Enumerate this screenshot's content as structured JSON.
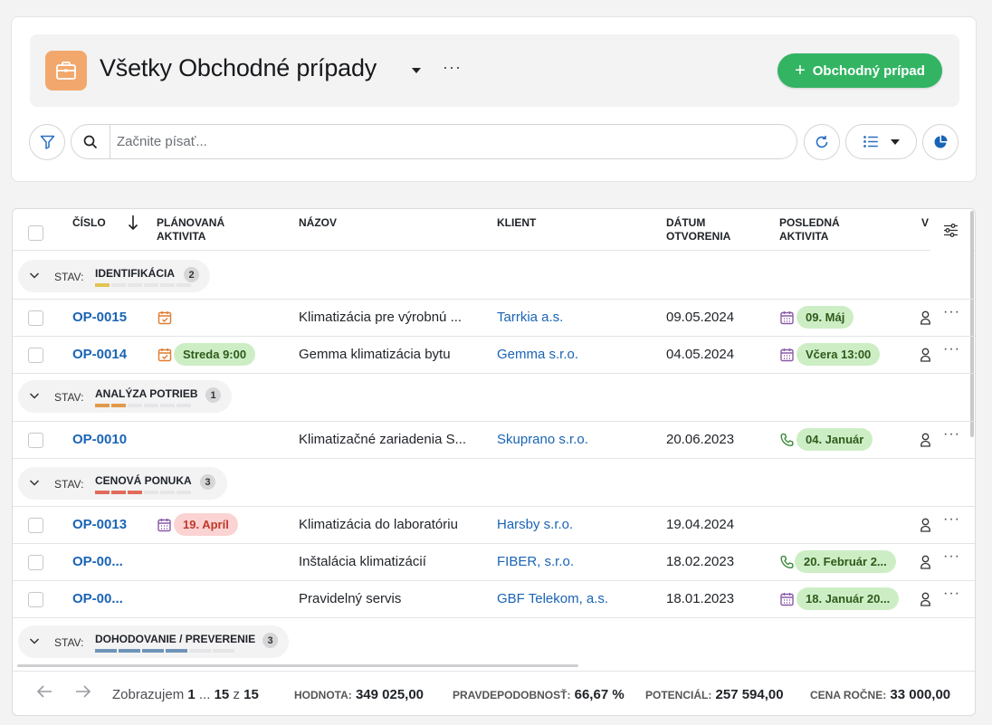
{
  "header": {
    "title": "Všetky Obchodné prípady",
    "more": "···",
    "add_button": "Obchodný prípad"
  },
  "search": {
    "placeholder": "Začnite písať..."
  },
  "table": {
    "columns": {
      "cislo": "Číslo",
      "planovana_1": "Plánovaná",
      "planovana_2": "aktivita",
      "nazov": "Názov",
      "klient": "Klient",
      "datum_1": "Dátum",
      "datum_2": "otvorenia",
      "posledna_1": "Posledná",
      "posledna_2": "aktivita",
      "cut": "V"
    },
    "groups": [
      {
        "stav": "STAV:",
        "name": "IDENTIFIKÁCIA",
        "count": "2"
      },
      {
        "stav": "STAV:",
        "name": "ANALÝZA POTRIEB",
        "count": "1"
      },
      {
        "stav": "STAV:",
        "name": "CENOVÁ PONUKA",
        "count": "3"
      },
      {
        "stav": "STAV:",
        "name": "DOHODOVANIE / PREVERENIE",
        "count": "3"
      }
    ],
    "rows": [
      {
        "number": "OP-0015",
        "name": "Klimatizácia pre výrobnú ...",
        "client": "Tarrkia a.s.",
        "date": "09.05.2024",
        "planned": "",
        "last": "09. Máj",
        "more": "···"
      },
      {
        "number": "OP-0014",
        "name": "Gemma klimatizácia bytu",
        "client": "Gemma s.r.o.",
        "date": "04.05.2024",
        "planned": "Streda 9:00",
        "last": "Včera 13:00",
        "more": "···"
      },
      {
        "number": "OP-0010",
        "name": "Klimatizačné zariadenia S...",
        "client": "Skuprano s.r.o.",
        "date": "20.06.2023",
        "planned": "",
        "last": "04. Január",
        "more": "···"
      },
      {
        "number": "OP-0013",
        "name": "Klimatizácia do laboratóriu",
        "client": "Harsby s.r.o.",
        "date": "19.04.2024",
        "planned": "19. Apríl",
        "last": "",
        "more": "···"
      },
      {
        "number": "OP-00...",
        "name": "Inštalácia klimatizácií",
        "client": "FIBER, s.r.o.",
        "date": "18.02.2023",
        "planned": "",
        "last": "20. Február 2...",
        "more": "···"
      },
      {
        "number": "OP-00...",
        "name": "Pravidelný servis",
        "client": "GBF Telekom, a.s.",
        "date": "18.01.2023",
        "planned": "",
        "last": "18. Január 20...",
        "more": "···"
      }
    ]
  },
  "footer": {
    "showing_label": "Zobrazujem",
    "range_start": "1",
    "ellipsis": "...",
    "range_end": "15",
    "of": "z",
    "total": "15",
    "hodnota_label": "HODNOTA:",
    "hodnota_value": "349 025,00",
    "pravdepodobnost_label": "PRAVDEPODOBNOSŤ:",
    "pravdepodobnost_value": "66,67 %",
    "potencial_label": "POTENCIÁL:",
    "potencial_value": "257 594,00",
    "cena_label": "CENA ROČNE:",
    "cena_value": "33 000,00"
  },
  "colors": {
    "accent_green": "#33b463",
    "app_icon": "#f2a86c",
    "link_blue": "#1a64b5",
    "identifikacia": "#e3c353",
    "analyza": "#e29a4a",
    "cenova": "#e26a5c",
    "dohodovanie": "#6f94b8"
  },
  "icons": [
    "briefcase-icon",
    "filter-icon",
    "search-icon",
    "refresh-icon",
    "list-icon",
    "pie-chart-icon",
    "sort-down-icon",
    "column-settings-icon",
    "chevron-down-icon",
    "calendar-check-icon",
    "calendar-icon",
    "phone-icon",
    "user-icon",
    "arrow-left-icon",
    "arrow-right-icon"
  ]
}
